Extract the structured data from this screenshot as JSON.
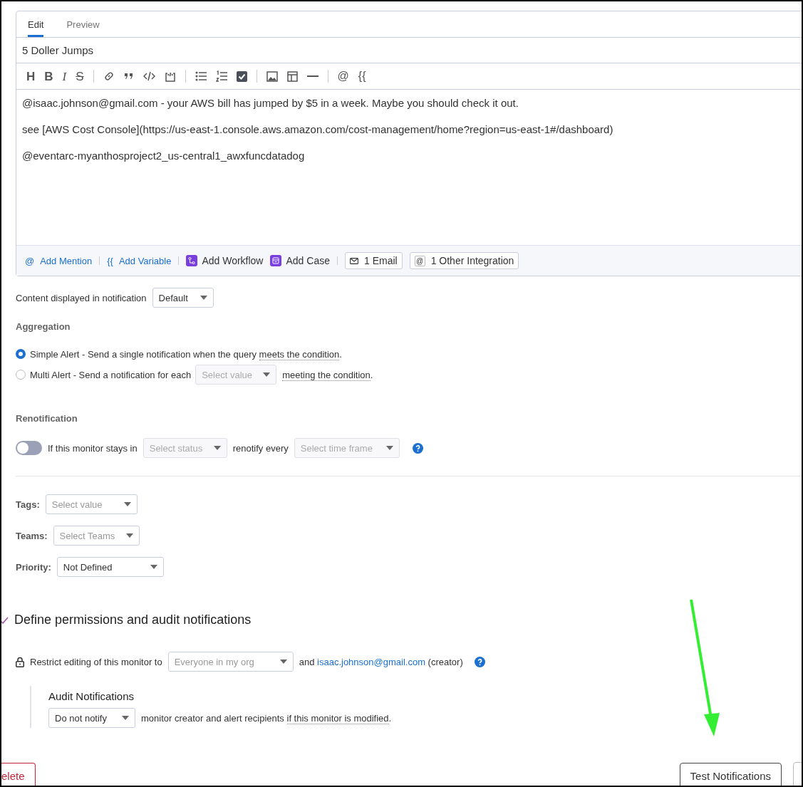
{
  "editor": {
    "tabs": [
      {
        "label": "Edit",
        "selected": true
      },
      {
        "label": "Preview",
        "selected": false
      }
    ],
    "title": "5 Doller Jumps",
    "toolbar": [
      [
        {
          "kind": "heading",
          "text": "H"
        },
        {
          "kind": "bold",
          "text": "B"
        },
        {
          "kind": "italic",
          "text": "I"
        },
        {
          "kind": "strike",
          "text": "S"
        }
      ],
      [
        {
          "kind": "link"
        },
        {
          "kind": "quote"
        },
        {
          "kind": "code"
        },
        {
          "kind": "code-block"
        }
      ],
      [
        {
          "kind": "bullets"
        },
        {
          "kind": "numbers"
        },
        {
          "kind": "checklist"
        }
      ],
      [
        {
          "kind": "image"
        },
        {
          "kind": "table"
        },
        {
          "kind": "rule"
        }
      ],
      [
        {
          "kind": "mention",
          "text": "@"
        },
        {
          "kind": "variable",
          "text": "{{"
        }
      ]
    ],
    "body": [
      "@isaac.johnson@gmail.com - your AWS bill has jumped by $5 in a week.  Maybe you should check it out.",
      "see [AWS Cost Console](https://us-east-1.console.aws.amazon.com/cost-management/home?region=us-east-1#/dashboard)",
      "@eventarc-myanthosproject2_us-central1_awxfuncdatadog"
    ],
    "footer": [
      {
        "kind": "link",
        "glyph": "@",
        "label": "Add Mention"
      },
      {
        "kind": "link",
        "glyph": "{{",
        "label": "Add Variable"
      },
      {
        "kind": "workflow",
        "label": "Add Workflow"
      },
      {
        "kind": "case",
        "label": "Add Case"
      },
      {
        "kind": "email",
        "label": "1 Email"
      },
      {
        "kind": "integration",
        "glyph": "@",
        "label": "1 Other Integration"
      }
    ]
  },
  "content_display": {
    "label": "Content displayed in notification",
    "select": {
      "value": "Default",
      "disabled": false
    }
  },
  "aggregation": {
    "heading": "Aggregation",
    "options": [
      {
        "label": "Simple Alert - Send a single notification when the query",
        "hint": "meets the condition",
        "end": ".",
        "selected": true
      },
      {
        "label": "Multi Alert - Send a notification for each",
        "select": {
          "placeholder": "Select value",
          "disabled": true
        },
        "hint": "meeting the condition",
        "end": ".",
        "selected": false
      }
    ]
  },
  "renotification": {
    "heading": "Renotification",
    "on": false,
    "label": "If this monitor stays in",
    "status_select": {
      "placeholder": "Select status",
      "disabled": true
    },
    "between": "renotify every",
    "time_select": {
      "placeholder": "Select time frame",
      "disabled": true
    }
  },
  "fields": [
    {
      "label": "Tags:",
      "select": {
        "placeholder": "Select value",
        "disabled": false
      }
    },
    {
      "label": "Teams:",
      "select": {
        "placeholder": "Select Teams",
        "disabled": false
      }
    },
    {
      "label": "Priority:",
      "select": {
        "value": "Not Defined",
        "disabled": false
      }
    }
  ],
  "permissions": {
    "heading": "Define permissions and audit notifications",
    "restrict_label": "Restrict editing of this monitor to",
    "restrict_select": {
      "placeholder": "Everyone in my org",
      "disabled": false
    },
    "and": "and",
    "creator_link": "isaac.johnson@gmail.com",
    "creator_note": "(creator)",
    "audit": {
      "heading": "Audit Notifications",
      "select": {
        "value": "Do not notify",
        "disabled": false
      },
      "text": "monitor creator and alert recipients",
      "hint": "if this monitor is modified",
      "end": "."
    }
  },
  "actions": [
    {
      "label": "elete",
      "kind": "danger"
    },
    {
      "label": "Test Notifications",
      "kind": "default"
    }
  ]
}
